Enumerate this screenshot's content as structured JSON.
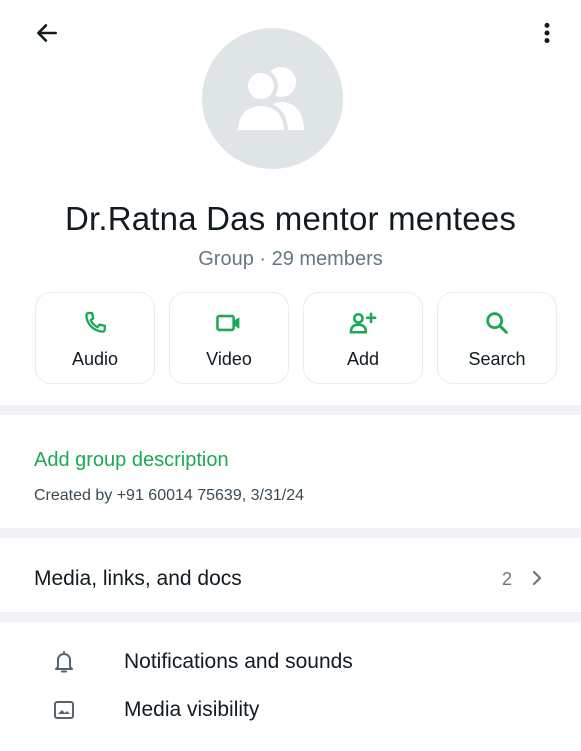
{
  "group": {
    "name": "Dr.Ratna Das mentor mentees",
    "meta": "Group · 29 members"
  },
  "actions": [
    {
      "label": "Audio",
      "icon": "phone-icon"
    },
    {
      "label": "Video",
      "icon": "video-camera-icon"
    },
    {
      "label": "Add",
      "icon": "add-person-icon"
    },
    {
      "label": "Search",
      "icon": "search-icon"
    }
  ],
  "description": {
    "add_label": "Add group description",
    "created_by": "Created by +91 60014 75639, 3/31/24"
  },
  "media": {
    "label": "Media, links, and docs",
    "count": "2"
  },
  "settings": [
    {
      "label": "Notifications and sounds",
      "icon": "bell-icon"
    },
    {
      "label": "Media visibility",
      "icon": "image-icon"
    }
  ],
  "colors": {
    "accent": "#1da855",
    "avatar_bg": "#dfe5e7",
    "secondary_text": "#667781",
    "divider": "#f0f2f5"
  }
}
